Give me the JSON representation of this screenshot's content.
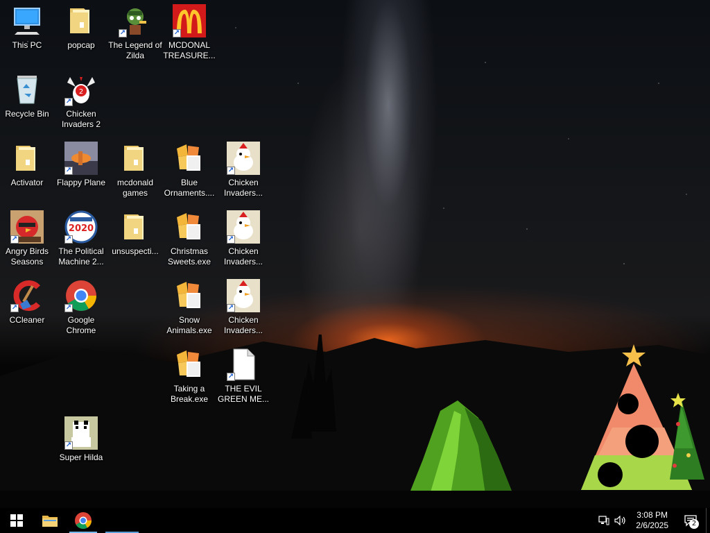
{
  "desktop_icons": [
    {
      "label": "This PC",
      "icon": "computer-icon",
      "shortcut": false
    },
    {
      "label": "popcap",
      "icon": "folder-icon",
      "shortcut": false
    },
    {
      "label": "The Legend of Zilda",
      "icon": "zilda-game-icon",
      "shortcut": true
    },
    {
      "label": "MCDONAL TREASURE...",
      "icon": "mcdonalds-logo-icon",
      "shortcut": true
    },
    {
      "label": "Recycle Bin",
      "icon": "recycle-bin-icon",
      "shortcut": false
    },
    {
      "label": "Chicken Invaders 2",
      "icon": "chicken-invaders-2-icon",
      "shortcut": true
    },
    {
      "label": "Activator",
      "icon": "folder-icon",
      "shortcut": false
    },
    {
      "label": "Flappy Plane",
      "icon": "flappy-plane-icon",
      "shortcut": true
    },
    {
      "label": "mcdonald games",
      "icon": "folder-icon",
      "shortcut": false
    },
    {
      "label": "Blue Ornaments....",
      "icon": "gift-exe-icon",
      "shortcut": false
    },
    {
      "label": "Chicken Invaders...",
      "icon": "chicken-invaders-icon",
      "shortcut": true
    },
    {
      "label": "Angry Birds Seasons",
      "icon": "angry-birds-icon",
      "shortcut": true
    },
    {
      "label": "The Political Machine 2...",
      "icon": "political-machine-icon",
      "shortcut": true
    },
    {
      "label": "unsuspecti...",
      "icon": "folder-icon",
      "shortcut": false
    },
    {
      "label": "Christmas Sweets.exe",
      "icon": "gift-exe-icon",
      "shortcut": false
    },
    {
      "label": "Chicken Invaders...",
      "icon": "chicken-invaders-icon",
      "shortcut": true
    },
    {
      "label": "CCleaner",
      "icon": "ccleaner-icon",
      "shortcut": true
    },
    {
      "label": "Google Chrome",
      "icon": "chrome-icon",
      "shortcut": true
    },
    {
      "label": "Snow Animals.exe",
      "icon": "gift-exe-icon",
      "shortcut": false
    },
    {
      "label": "Chicken Invaders...",
      "icon": "chicken-invaders-icon",
      "shortcut": true
    },
    {
      "label": "Taking a Break.exe",
      "icon": "gift-exe-icon",
      "shortcut": false
    },
    {
      "label": "THE EVIL GREEN ME...",
      "icon": "blank-file-icon",
      "shortcut": true
    },
    {
      "label": "Super Hilda",
      "icon": "super-hilda-icon",
      "shortcut": true
    }
  ],
  "taskbar": {
    "start": {
      "icon": "windows-start-icon"
    },
    "pinned": [
      {
        "name": "file-explorer",
        "icon": "folder-icon",
        "active": false
      },
      {
        "name": "google-chrome",
        "icon": "chrome-icon",
        "active": true
      }
    ],
    "tray": {
      "time": "3:08 PM",
      "date": "2/6/2025",
      "notification_count": "2"
    }
  }
}
